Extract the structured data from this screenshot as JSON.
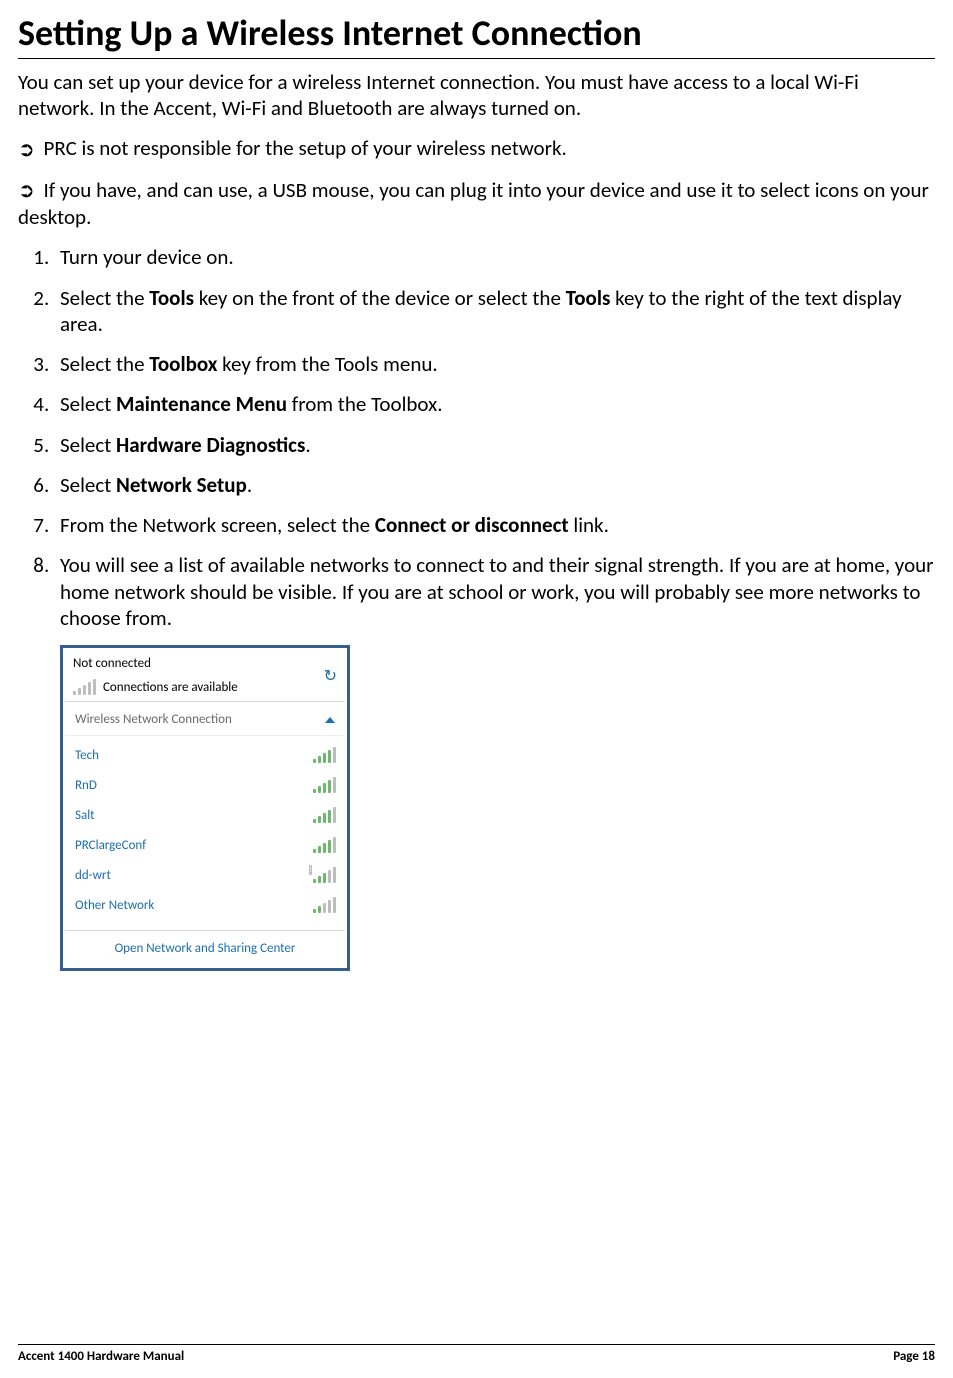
{
  "title": "Setting Up a Wireless Internet Connection",
  "intro": "You can set up your device for a wireless Internet connection. You must have access to a local Wi-Fi network. In the Accent, Wi-Fi and Bluetooth are always turned on.",
  "notes": [
    "PRC is not responsible for the setup of your wireless network.",
    "If you have, and can use, a USB mouse, you can plug it into your device and use it to select icons on your desktop."
  ],
  "steps": [
    {
      "pre": "Turn your device on."
    },
    {
      "pre": "Select the ",
      "b1": "Tools",
      "mid": " key on the front of the device or select the ",
      "b2": "Tools",
      "post": " key to the right of the text display area."
    },
    {
      "pre": "Select the ",
      "b1": "Toolbox",
      "post": " key from the Tools menu."
    },
    {
      "pre": "Select ",
      "b1": "Maintenance Menu",
      "post": " from the Toolbox."
    },
    {
      "pre": "Select ",
      "b1": "Hardware Diagnostics",
      "post": "."
    },
    {
      "pre": "Select ",
      "b1": "Network Setup",
      "post": "."
    },
    {
      "pre": "From the Network screen, select the ",
      "b1": "Connect or disconnect",
      "post": " link."
    },
    {
      "pre": "You will see a list of available networks to connect to and their signal strength. If you are at home, your home network should be visible. If you are at school or work, you will probably see more networks to choose from."
    }
  ],
  "screenshot": {
    "not_connected": "Not connected",
    "avail": "Connections are available",
    "section": "Wireless Network Connection",
    "networks": [
      {
        "name": "Tech",
        "bars": 4,
        "warn": false
      },
      {
        "name": "RnD",
        "bars": 4,
        "warn": false
      },
      {
        "name": "Salt",
        "bars": 4,
        "warn": false
      },
      {
        "name": "PRClargeConf",
        "bars": 4,
        "warn": false
      },
      {
        "name": "dd-wrt",
        "bars": 3,
        "warn": true
      },
      {
        "name": "Other Network",
        "bars": 2,
        "warn": false
      }
    ],
    "footer": "Open Network and Sharing Center"
  },
  "footer": {
    "left": "Accent 1400 Hardware Manual",
    "right": "Page 18"
  }
}
